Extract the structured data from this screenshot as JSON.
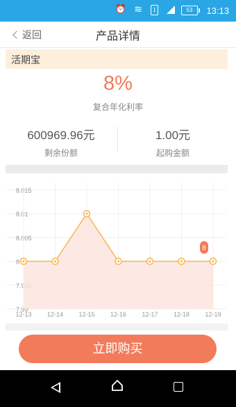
{
  "status_bar": {
    "time": "13:13",
    "battery": "53",
    "sim": "1"
  },
  "nav": {
    "back_label": "返回",
    "title": "产品详情"
  },
  "product": {
    "name": "活期宝",
    "rate": "8%",
    "rate_label": "复合年化利率"
  },
  "stats": [
    {
      "value": "600969.96元",
      "label": "剩余份额"
    },
    {
      "value": "1.00元",
      "label": "起购金额"
    }
  ],
  "chart_data": {
    "type": "area",
    "x": [
      "12-13",
      "12-14",
      "12-15",
      "12-16",
      "12-17",
      "12-18",
      "12-19"
    ],
    "x_tick_labels": [
      "12-13",
      "12-14",
      "12-15",
      "12-16",
      "12-17",
      "12-18",
      "12-19"
    ],
    "y": [
      8,
      8,
      8.01,
      8,
      8,
      8,
      8
    ],
    "y_tick_labels": [
      "8.015",
      "8.01",
      "8.005",
      "8",
      "7.995",
      "7.99"
    ],
    "ylim": [
      7.99,
      8.015
    ],
    "highlight": {
      "index": 6,
      "label": "8"
    },
    "colors": {
      "line": "#f5b95a",
      "fill": "#fde5df",
      "badge": "#f27b5b"
    }
  },
  "buy_button": {
    "label": "立即购买"
  },
  "colors": {
    "accent": "#f27b5b",
    "status_bar": "#29a6e3",
    "section_head_bg": "#fdefdc"
  }
}
